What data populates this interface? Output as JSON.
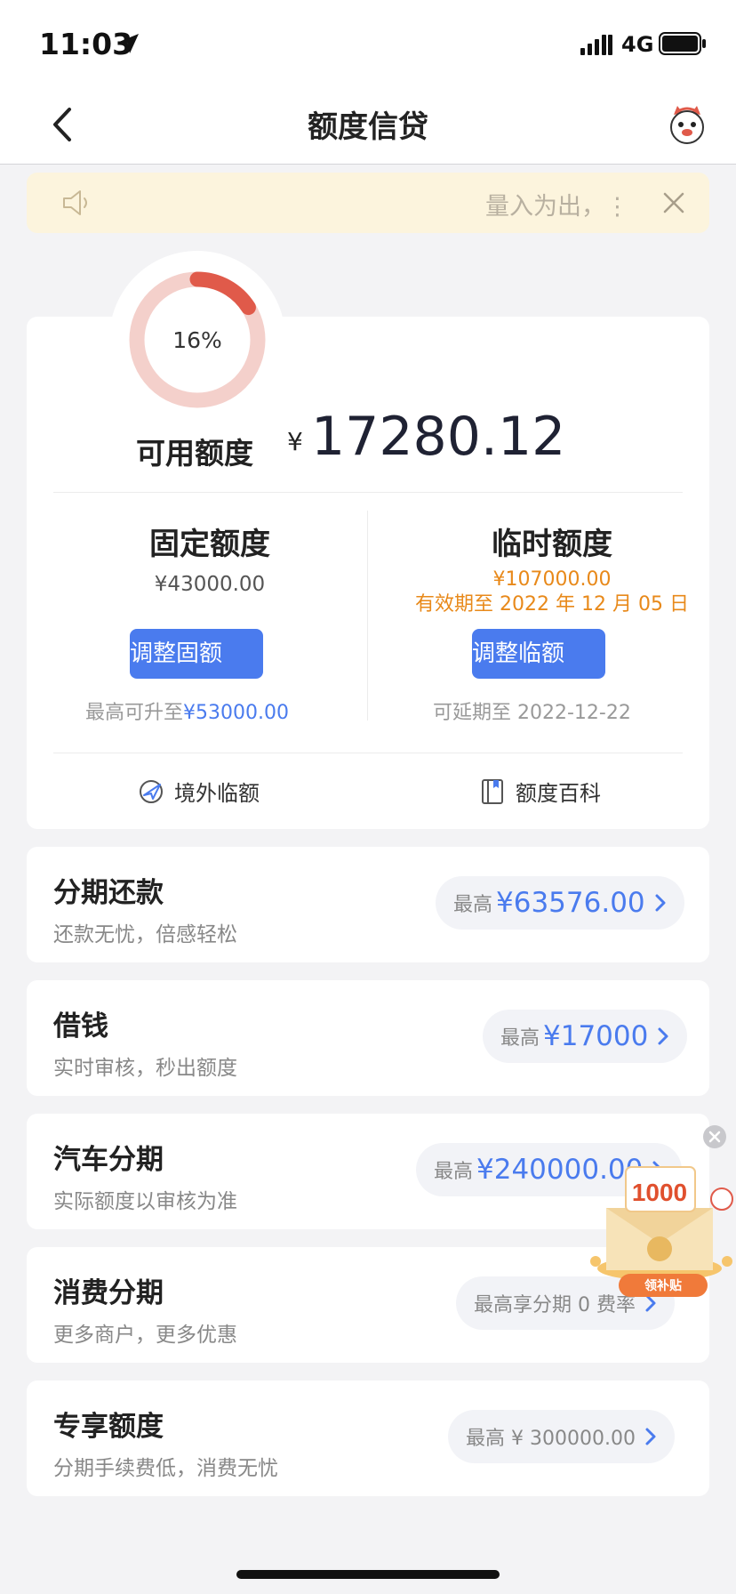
{
  "status_bar": {
    "time": "11:03",
    "network": "4G"
  },
  "nav": {
    "title": "额度信贷"
  },
  "notice": {
    "text": "量入为出，⋮"
  },
  "quota": {
    "used_percent_label": "16%",
    "used_fraction": 0.16,
    "available_label": "可用额度",
    "currency_symbol": "¥",
    "available_amount": "17280.12",
    "fixed": {
      "title": "固定额度",
      "amount": "¥43000.00",
      "button": "调整固额",
      "hint_prefix": "最高可升至",
      "hint_amount": "¥53000.00"
    },
    "temporary": {
      "title": "临时额度",
      "amount": "¥107000.00",
      "valid_until": "有效期至 2022 年 12 月 05 日",
      "button": "调整临额",
      "hint": "可延期至 2022-12-22"
    },
    "links": {
      "overseas": "境外临额",
      "wiki": "额度百科"
    }
  },
  "rows": [
    {
      "title": "分期还款",
      "subtitle": "还款无忧，倍感轻松",
      "pill_label": "最高",
      "pill_amount": "¥63576.00"
    },
    {
      "title": "借钱",
      "subtitle": "实时审核，秒出额度",
      "pill_label": "最高",
      "pill_amount": "¥17000"
    },
    {
      "title": "汽车分期",
      "subtitle": "实际额度以审核为准",
      "pill_label": "最高",
      "pill_amount": "¥240000.00"
    },
    {
      "title": "消费分期",
      "subtitle": "更多商户，更多优惠",
      "pill_text": "最高享分期 0 费率"
    },
    {
      "title": "专享额度",
      "subtitle": "分期手续费低，消费无忧",
      "pill_text": "最高 ¥ 300000.00"
    }
  ],
  "promo": {
    "amount": "1000",
    "label": "领补贴"
  },
  "colors": {
    "accent_blue": "#4a7bee",
    "accent_orange": "#e8891a",
    "ring_red": "#e05a4a",
    "ring_track": "#f4d0cb",
    "notice_bg": "#fcf4dd"
  },
  "icons": [
    "location-arrow-icon",
    "signal-icon",
    "battery-icon",
    "back-chevron-icon",
    "mascot-icon",
    "speaker-icon",
    "close-icon",
    "plane-icon",
    "book-icon",
    "chevron-right-icon",
    "red-packet-icon"
  ]
}
